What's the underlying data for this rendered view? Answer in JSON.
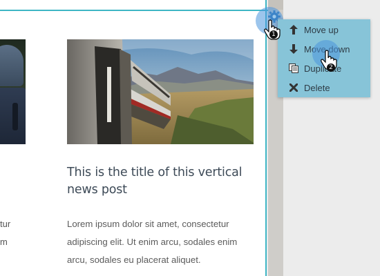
{
  "post": {
    "left_text_1": "tur",
    "left_text_2": "m",
    "title": "This is the title of this vertical news post",
    "body": "Lorem ipsum dolor sit amet, consectetur adipiscing elit. Ut enim arcu, sodales enim arcu, sodales eu placerat aliquet."
  },
  "menu": {
    "items": [
      {
        "label": "Move up",
        "icon": "arrow-up-icon"
      },
      {
        "label": "Move down",
        "icon": "arrow-down-icon"
      },
      {
        "label": "Duplicate",
        "icon": "copy-icon"
      },
      {
        "label": "Delete",
        "icon": "close-icon"
      }
    ]
  },
  "annotations": {
    "step1": "1",
    "step2": "2"
  },
  "colors": {
    "accent": "#3eb6c5",
    "menu_bg": "#87c4d8",
    "halo": "#4b96dc"
  }
}
